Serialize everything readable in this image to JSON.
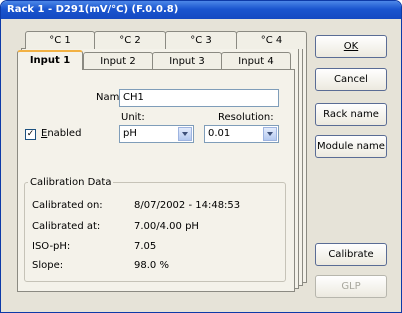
{
  "window": {
    "title": "Rack 1 - D291(mV/°C) (F.0.0.8)"
  },
  "tabs_back": [
    "°C 1",
    "°C 2",
    "°C 3",
    "°C 4"
  ],
  "tabs_front": [
    "Input 1",
    "Input 2",
    "Input 3",
    "Input 4"
  ],
  "form": {
    "name_label": "Name:",
    "name_value": "CH1",
    "enabled_label": "Enabled",
    "enabled_checked": true,
    "unit_label": "Unit:",
    "unit_value": "pH",
    "resolution_label": "Resolution:",
    "resolution_value": "0.01"
  },
  "calibration": {
    "group_title": "Calibration Data",
    "rows": [
      {
        "label": "Calibrated on:",
        "value": "8/07/2002 - 14:48:53"
      },
      {
        "label": "Calibrated at:",
        "value": "7.00/4.00 pH"
      },
      {
        "label": "ISO-pH:",
        "value": "7.05"
      },
      {
        "label": "Slope:",
        "value": "98.0 %"
      }
    ]
  },
  "buttons": {
    "ok": "OK",
    "cancel": "Cancel",
    "rack_name": "Rack name",
    "module_name": "Module name",
    "calibrate": "Calibrate",
    "glp": "GLP"
  }
}
